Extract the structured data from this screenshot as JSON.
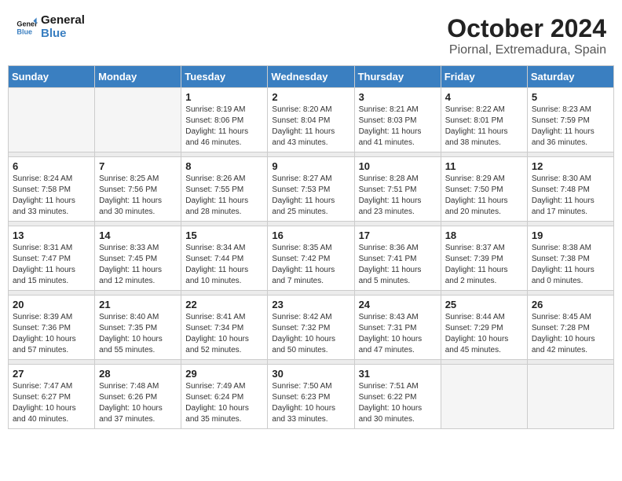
{
  "header": {
    "logo_line1": "General",
    "logo_line2": "Blue",
    "month": "October 2024",
    "location": "Piornal, Extremadura, Spain"
  },
  "weekdays": [
    "Sunday",
    "Monday",
    "Tuesday",
    "Wednesday",
    "Thursday",
    "Friday",
    "Saturday"
  ],
  "weeks": [
    [
      {
        "day": "",
        "empty": true
      },
      {
        "day": "",
        "empty": true
      },
      {
        "day": "1",
        "rise": "8:19 AM",
        "set": "8:06 PM",
        "daylight": "11 hours and 46 minutes."
      },
      {
        "day": "2",
        "rise": "8:20 AM",
        "set": "8:04 PM",
        "daylight": "11 hours and 43 minutes."
      },
      {
        "day": "3",
        "rise": "8:21 AM",
        "set": "8:03 PM",
        "daylight": "11 hours and 41 minutes."
      },
      {
        "day": "4",
        "rise": "8:22 AM",
        "set": "8:01 PM",
        "daylight": "11 hours and 38 minutes."
      },
      {
        "day": "5",
        "rise": "8:23 AM",
        "set": "7:59 PM",
        "daylight": "11 hours and 36 minutes."
      }
    ],
    [
      {
        "day": "6",
        "rise": "8:24 AM",
        "set": "7:58 PM",
        "daylight": "11 hours and 33 minutes."
      },
      {
        "day": "7",
        "rise": "8:25 AM",
        "set": "7:56 PM",
        "daylight": "11 hours and 30 minutes."
      },
      {
        "day": "8",
        "rise": "8:26 AM",
        "set": "7:55 PM",
        "daylight": "11 hours and 28 minutes."
      },
      {
        "day": "9",
        "rise": "8:27 AM",
        "set": "7:53 PM",
        "daylight": "11 hours and 25 minutes."
      },
      {
        "day": "10",
        "rise": "8:28 AM",
        "set": "7:51 PM",
        "daylight": "11 hours and 23 minutes."
      },
      {
        "day": "11",
        "rise": "8:29 AM",
        "set": "7:50 PM",
        "daylight": "11 hours and 20 minutes."
      },
      {
        "day": "12",
        "rise": "8:30 AM",
        "set": "7:48 PM",
        "daylight": "11 hours and 17 minutes."
      }
    ],
    [
      {
        "day": "13",
        "rise": "8:31 AM",
        "set": "7:47 PM",
        "daylight": "11 hours and 15 minutes."
      },
      {
        "day": "14",
        "rise": "8:33 AM",
        "set": "7:45 PM",
        "daylight": "11 hours and 12 minutes."
      },
      {
        "day": "15",
        "rise": "8:34 AM",
        "set": "7:44 PM",
        "daylight": "11 hours and 10 minutes."
      },
      {
        "day": "16",
        "rise": "8:35 AM",
        "set": "7:42 PM",
        "daylight": "11 hours and 7 minutes."
      },
      {
        "day": "17",
        "rise": "8:36 AM",
        "set": "7:41 PM",
        "daylight": "11 hours and 5 minutes."
      },
      {
        "day": "18",
        "rise": "8:37 AM",
        "set": "7:39 PM",
        "daylight": "11 hours and 2 minutes."
      },
      {
        "day": "19",
        "rise": "8:38 AM",
        "set": "7:38 PM",
        "daylight": "11 hours and 0 minutes."
      }
    ],
    [
      {
        "day": "20",
        "rise": "8:39 AM",
        "set": "7:36 PM",
        "daylight": "10 hours and 57 minutes."
      },
      {
        "day": "21",
        "rise": "8:40 AM",
        "set": "7:35 PM",
        "daylight": "10 hours and 55 minutes."
      },
      {
        "day": "22",
        "rise": "8:41 AM",
        "set": "7:34 PM",
        "daylight": "10 hours and 52 minutes."
      },
      {
        "day": "23",
        "rise": "8:42 AM",
        "set": "7:32 PM",
        "daylight": "10 hours and 50 minutes."
      },
      {
        "day": "24",
        "rise": "8:43 AM",
        "set": "7:31 PM",
        "daylight": "10 hours and 47 minutes."
      },
      {
        "day": "25",
        "rise": "8:44 AM",
        "set": "7:29 PM",
        "daylight": "10 hours and 45 minutes."
      },
      {
        "day": "26",
        "rise": "8:45 AM",
        "set": "7:28 PM",
        "daylight": "10 hours and 42 minutes."
      }
    ],
    [
      {
        "day": "27",
        "rise": "7:47 AM",
        "set": "6:27 PM",
        "daylight": "10 hours and 40 minutes."
      },
      {
        "day": "28",
        "rise": "7:48 AM",
        "set": "6:26 PM",
        "daylight": "10 hours and 37 minutes."
      },
      {
        "day": "29",
        "rise": "7:49 AM",
        "set": "6:24 PM",
        "daylight": "10 hours and 35 minutes."
      },
      {
        "day": "30",
        "rise": "7:50 AM",
        "set": "6:23 PM",
        "daylight": "10 hours and 33 minutes."
      },
      {
        "day": "31",
        "rise": "7:51 AM",
        "set": "6:22 PM",
        "daylight": "10 hours and 30 minutes."
      },
      {
        "day": "",
        "empty": true
      },
      {
        "day": "",
        "empty": true
      }
    ]
  ]
}
